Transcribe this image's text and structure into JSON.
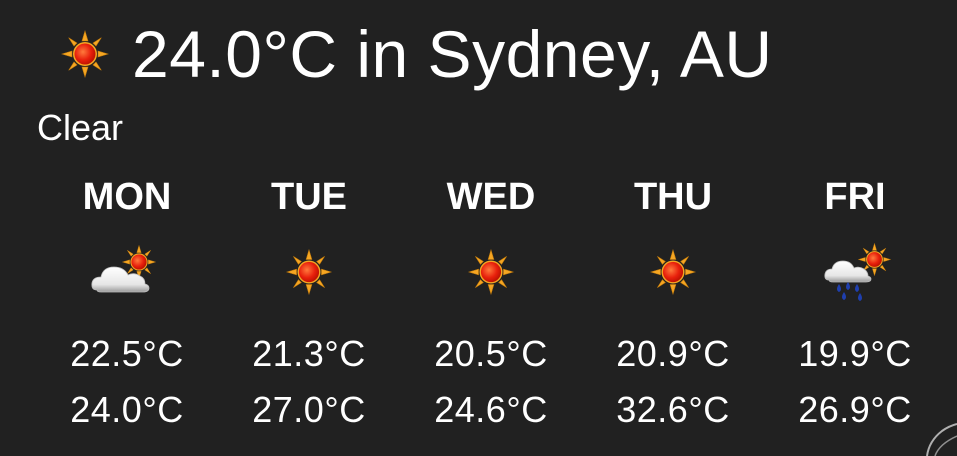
{
  "header": {
    "icon": "sun-icon",
    "title": "24.0°C in Sydney, AU"
  },
  "condition": "Clear",
  "forecast": [
    {
      "day": "MON",
      "icon": "partly-cloudy-icon",
      "temp_low": "22.5°C",
      "temp_high": "24.0°C"
    },
    {
      "day": "TUE",
      "icon": "sun-icon",
      "temp_low": "21.3°C",
      "temp_high": "27.0°C"
    },
    {
      "day": "WED",
      "icon": "sun-icon",
      "temp_low": "20.5°C",
      "temp_high": "24.6°C"
    },
    {
      "day": "THU",
      "icon": "sun-icon",
      "temp_low": "20.9°C",
      "temp_high": "32.6°C"
    },
    {
      "day": "FRI",
      "icon": "rain-sun-icon",
      "temp_low": "19.9°C",
      "temp_high": "26.9°C"
    }
  ],
  "colors": {
    "background": "#212121",
    "text": "#ffffff",
    "sun_core": "#e8200c",
    "sun_rays": "#f5a623",
    "rain": "#1f3fae"
  }
}
